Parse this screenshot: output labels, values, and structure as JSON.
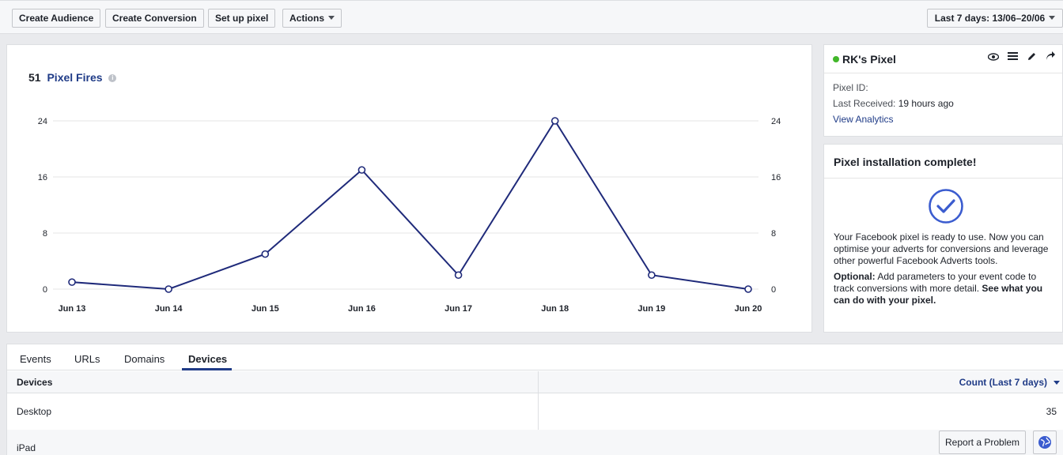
{
  "toolbar": {
    "create_audience": "Create Audience",
    "create_conversion": "Create Conversion",
    "set_up_pixel": "Set up pixel",
    "actions": "Actions",
    "date_range": "Last 7 days: 13/06–20/06"
  },
  "chart_card": {
    "count": "51",
    "title": "Pixel Fires",
    "info_icon": "info-icon"
  },
  "chart_data": {
    "type": "line",
    "categories": [
      "Jun 13",
      "Jun 14",
      "Jun 15",
      "Jun 16",
      "Jun 17",
      "Jun 18",
      "Jun 19",
      "Jun 20"
    ],
    "values": [
      1,
      0,
      5,
      17,
      2,
      24,
      2,
      0
    ],
    "ylim": [
      0,
      24
    ],
    "yticks": [
      0,
      8,
      16,
      24
    ],
    "grid": true,
    "line_color": "#1f2a7a"
  },
  "pixel_card": {
    "name": "RK's Pixel",
    "status_color": "#42b72a",
    "pixel_id_label": "Pixel ID:",
    "last_received_label": "Last Received:",
    "last_received_value": "19 hours ago",
    "view_analytics": "View Analytics",
    "icons": [
      "eye-icon",
      "list-icon",
      "pencil-icon",
      "share-icon"
    ]
  },
  "install_card": {
    "title": "Pixel installation complete!",
    "body": "Your Facebook pixel is ready to use. Now you can optimise your adverts for conversions and leverage other powerful Facebook Adverts tools.",
    "optional_label": "Optional:",
    "optional_text": "Add parameters to your event code to track conversions with more detail.",
    "see_what": "See what you can do with your pixel."
  },
  "tabs": {
    "items": [
      "Events",
      "URLs",
      "Domains",
      "Devices"
    ],
    "active": "Devices"
  },
  "table": {
    "col_devices": "Devices",
    "col_count": "Count (Last 7 days)",
    "rows": [
      {
        "name": "Desktop",
        "count": "35"
      },
      {
        "name": "iPad",
        "count": ""
      }
    ]
  },
  "footer": {
    "report_problem": "Report a Problem",
    "globe_icon": "globe-icon"
  }
}
